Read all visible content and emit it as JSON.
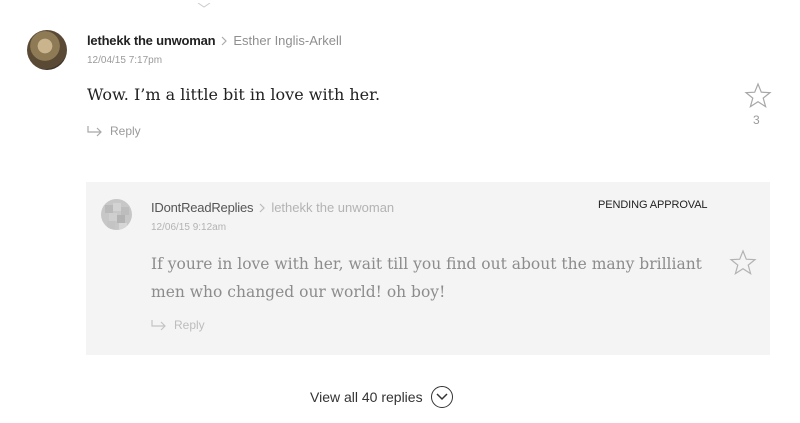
{
  "comment": {
    "author": "lethekk the unwoman",
    "reply_to": "Esther Inglis-Arkell",
    "timestamp": "12/04/15 7:17pm",
    "text": "Wow. I’m a little bit in love with her.",
    "star_count": "3",
    "reply_label": "Reply",
    "icons": {
      "avatar": "avatar-image",
      "star": "star-icon",
      "reply": "reply-arrow-icon",
      "separator": "chevron-right-icon"
    }
  },
  "reply": {
    "author": "IDontReadReplies",
    "reply_to": "lethekk the unwoman",
    "timestamp": "12/06/15 9:12am",
    "status": "PENDING APPROVAL",
    "text_line1": "If youre in love with her, wait till you find out about the many brilliant",
    "text_line2": "men who changed our world! oh boy!",
    "reply_label": "Reply",
    "icons": {
      "avatar": "pixelated-avatar",
      "star": "star-icon",
      "reply": "reply-arrow-icon"
    }
  },
  "view_all": {
    "label": "View all 40 replies",
    "icon": "chevron-down-circle-icon"
  },
  "colors": {
    "reply_background": "#f4f4f4",
    "muted_text": "#9a9a9a"
  }
}
